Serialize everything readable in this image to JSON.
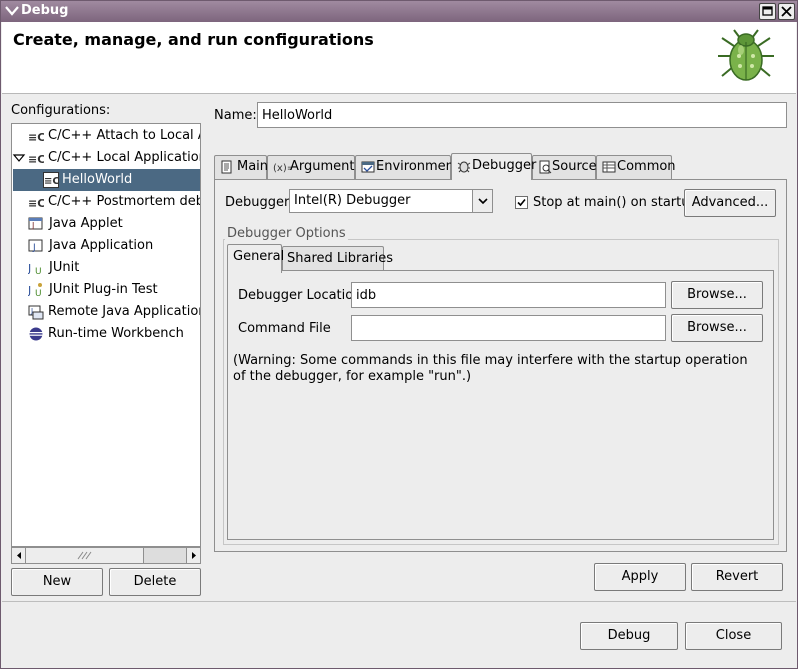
{
  "window": {
    "title": "Debug"
  },
  "header": {
    "heading": "Create, manage, and run configurations",
    "logo_icon": "debug-bug-icon"
  },
  "configurations": {
    "label": "Configurations:",
    "items": [
      {
        "label": "C/C++ Attach to Local Ap",
        "icon": "cpp-config-icon",
        "level": 1
      },
      {
        "label": "C/C++ Local Application",
        "icon": "cpp-config-icon",
        "level": 1,
        "expanded": true
      },
      {
        "label": "HelloWorld",
        "icon": "cpp-config-icon",
        "level": 2,
        "selected": true
      },
      {
        "label": "C/C++ Postmortem debug",
        "icon": "cpp-config-icon",
        "level": 1
      },
      {
        "label": "Java Applet",
        "icon": "java-applet-icon",
        "level": 1
      },
      {
        "label": "Java Application",
        "icon": "java-application-icon",
        "level": 1
      },
      {
        "label": "JUnit",
        "icon": "junit-icon",
        "level": 1
      },
      {
        "label": "JUnit Plug-in Test",
        "icon": "junit-plugin-icon",
        "level": 1
      },
      {
        "label": "Remote Java Application",
        "icon": "remote-java-icon",
        "level": 1
      },
      {
        "label": "Run-time Workbench",
        "icon": "workbench-icon",
        "level": 1
      }
    ],
    "new_label": "New",
    "delete_label": "Delete"
  },
  "name_field": {
    "label": "Name:",
    "value": "HelloWorld"
  },
  "tabs": [
    {
      "label": "Main",
      "icon": "main-tab-icon"
    },
    {
      "label": "Arguments",
      "icon": "arguments-tab-icon"
    },
    {
      "label": "Environment",
      "icon": "environment-tab-icon"
    },
    {
      "label": "Debugger",
      "icon": "debugger-tab-icon",
      "active": true
    },
    {
      "label": "Source",
      "icon": "source-tab-icon"
    },
    {
      "label": "Common",
      "icon": "common-tab-icon"
    }
  ],
  "debugger": {
    "label": "Debugger:",
    "selected": "Intel(R) Debugger",
    "stop_at_main_label": "Stop at main() on startup",
    "stop_at_main_checked": true,
    "advanced_label": "Advanced...",
    "options_label": "Debugger Options",
    "subtabs": [
      {
        "label": "General",
        "active": true
      },
      {
        "label": "Shared Libraries"
      }
    ],
    "location_label": "Debugger Location",
    "location_value": "idb",
    "command_file_label": "Command File",
    "command_file_value": "",
    "browse_label": "Browse...",
    "warning": "(Warning: Some commands in this file may interfere with the startup operation of the debugger, for example \"run\".)"
  },
  "actions": {
    "apply_label": "Apply",
    "revert_label": "Revert",
    "debug_label": "Debug",
    "close_label": "Close"
  }
}
